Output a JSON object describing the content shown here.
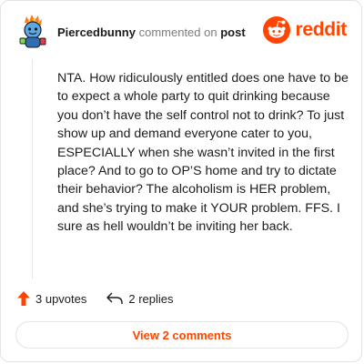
{
  "comment": {
    "username": "Piercedbunny",
    "action_text": "commented on",
    "target": "post",
    "body": "NTA. How ridiculously entitled does one have to be to expect a whole party to quit drinking because you don’t have the self control not to drink? To just show up and demand everyone cater to you, ESPECIALLY when she wasn’t invited in the first place? And to go to OP’S home and try to dictate their behavior? The alcoholism is HER problem, and she’s trying to make it YOUR problem. FFS. I sure as hell wouldn’t be inviting her back."
  },
  "brand": {
    "wordmark": "reddit",
    "icon": "reddit-logo-icon",
    "color": "#ff4500"
  },
  "actions": {
    "upvotes": "3 upvotes",
    "upvote_icon": "upvote-arrow-icon",
    "upvote_color": "#ff4500",
    "replies": "2 replies",
    "reply_icon": "reply-arrow-icon"
  },
  "footer": {
    "view_comments": "View 2 comments"
  },
  "avatar": {
    "icon": "snoo-avatar-icon"
  }
}
